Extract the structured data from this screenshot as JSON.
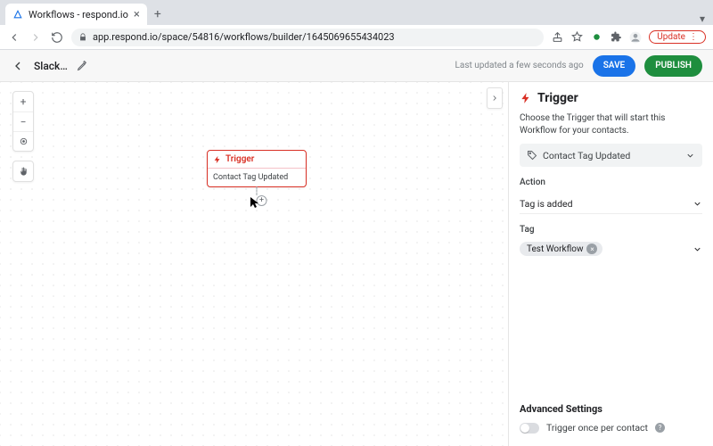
{
  "browser": {
    "tab_title": "Workflows - respond.io",
    "url": "app.respond.io/space/54816/workflows/builder/1645069655434023",
    "update_label": "Update"
  },
  "toolbar": {
    "workflow_name": "Slack…",
    "last_saved": "Last updated a few seconds ago",
    "save_label": "SAVE",
    "publish_label": "PUBLISH"
  },
  "node": {
    "title": "Trigger",
    "subtitle": "Contact Tag Updated"
  },
  "panel": {
    "title": "Trigger",
    "description": "Choose the Trigger that will start this Workflow for your contacts.",
    "trigger_type": "Contact Tag Updated",
    "action_label": "Action",
    "action_value": "Tag is added",
    "tag_label": "Tag",
    "tag_chip": "Test Workflow",
    "advanced_label": "Advanced Settings",
    "toggle_label": "Trigger once per contact"
  }
}
